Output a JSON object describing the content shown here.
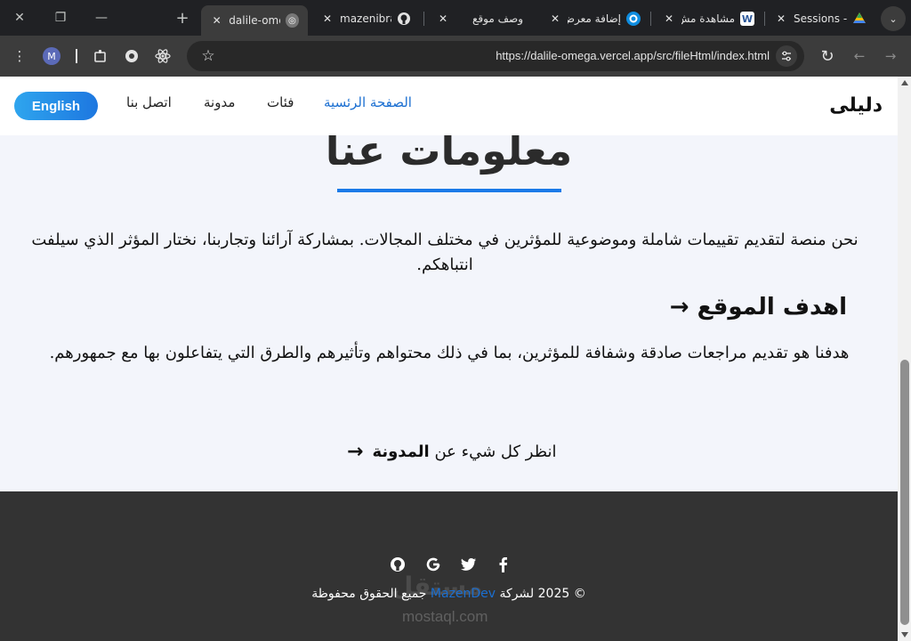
{
  "tabstrip": {
    "tabs": [
      {
        "title": "dalile-omega",
        "favicon": "globe-icon",
        "active": true
      },
      {
        "title": "mazenibra",
        "favicon": "github-icon",
        "active": false
      },
      {
        "title": "وصف موقع",
        "favicon": "",
        "active": false
      },
      {
        "title": "إضافة معرض",
        "favicon": "mostaql-icon",
        "active": false
      },
      {
        "title": "مشاهدة مش",
        "favicon": "w-icon",
        "active": false
      },
      {
        "title": "Sessions -",
        "favicon": "drive-icon",
        "active": false
      }
    ]
  },
  "toolbar": {
    "profile_initial": "M",
    "url": "https://dalile-omega.vercel.app/src/fileHtml/index.html"
  },
  "page": {
    "navbar": {
      "brand": "دليلى",
      "links": [
        "الصفحة الرئسية",
        "فئات",
        "مدونة",
        "اتصل بنا"
      ],
      "active_link": "الصفحة الرئسية",
      "lang_button": "English"
    },
    "about": {
      "title": "معلومات عنا",
      "text": "نحن منصة لتقديم تقييمات شاملة وموضوعية للمؤثرين في مختلف المجالات. بمشاركة آرائنا وتجاربنا، نختار المؤثر الذي سيلفت انتباهكم.",
      "goal_heading": "اهدف الموقع",
      "goal_text": "هدفنا هو تقديم مراجعات صادقة وشفافة للمؤثرين، بما في ذلك محتواهم وتأثيرهم والطرق التي يتفاعلون بها مع جمهورهم.",
      "blog_link_prefix": "انظر كل شيء عن",
      "blog_link_strong": "المدونة"
    },
    "footer": {
      "social": [
        "github-icon",
        "google-icon",
        "twitter-icon",
        "facebook-icon"
      ],
      "copyright_start": "© 2025 لشركة",
      "company": "MazenDev",
      "copyright_end": "جميع الحقوق محفوظة",
      "watermark_ar": "مستقل",
      "watermark_en": "mostaql.com"
    }
  },
  "colors": {
    "accent": "#1b7ae8",
    "footer_bg": "#333333",
    "page_bg": "#f3f5fb"
  }
}
